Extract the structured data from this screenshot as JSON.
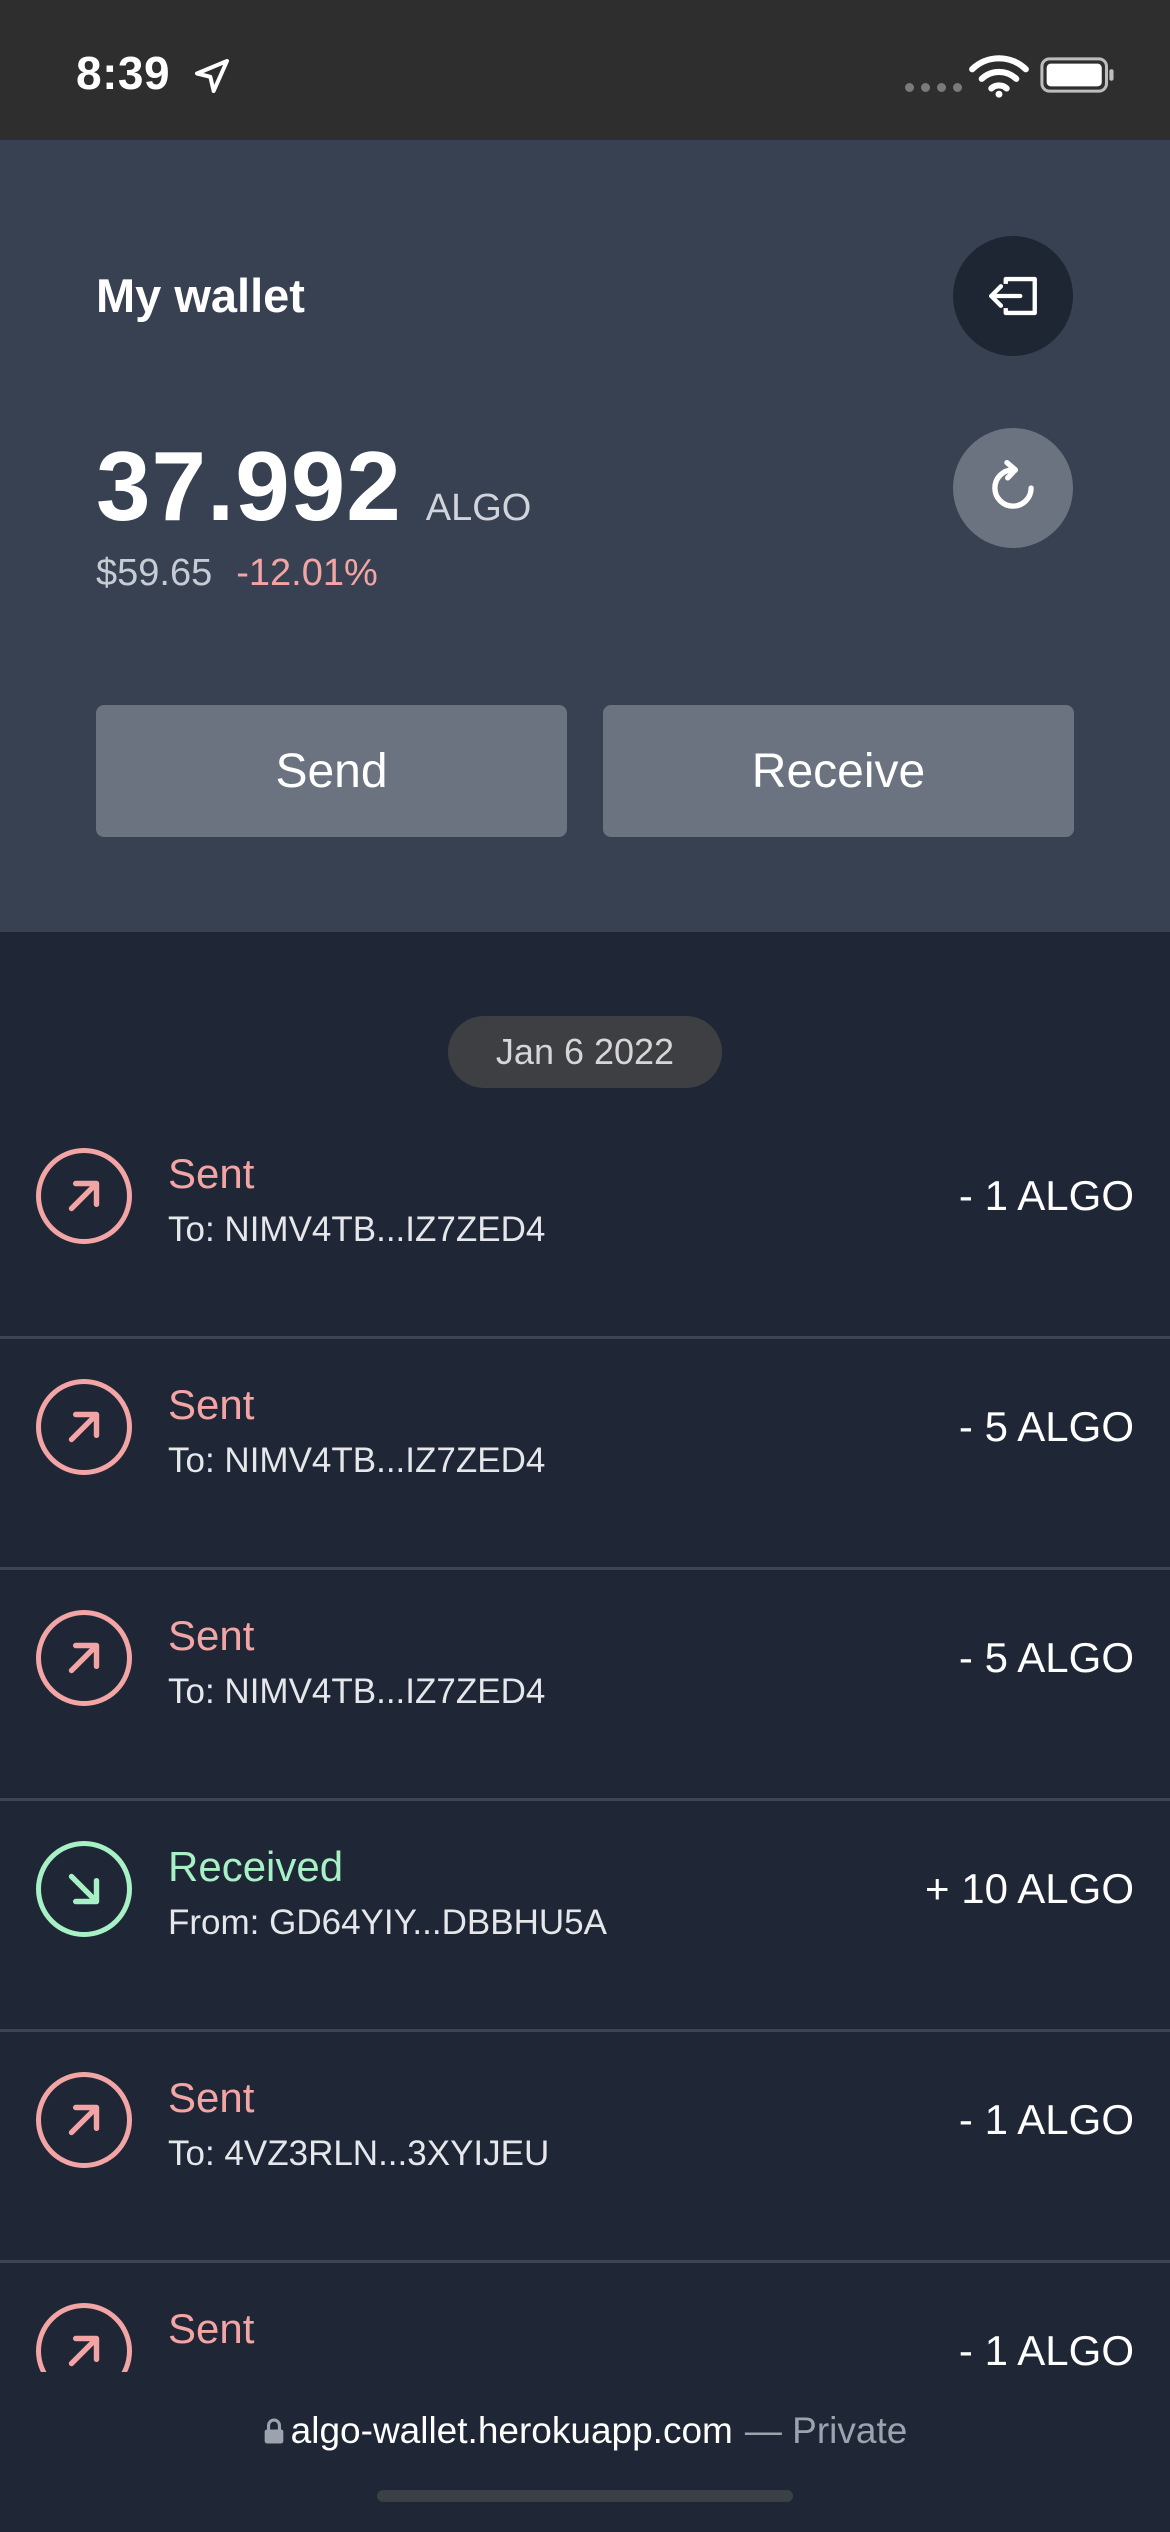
{
  "status_bar": {
    "time": "8:39"
  },
  "wallet": {
    "title": "My wallet",
    "balance": "37.992",
    "unit": "ALGO",
    "fiat_value": "$59.65",
    "change": "-12.01%",
    "send_label": "Send",
    "receive_label": "Receive"
  },
  "transactions": {
    "date": "Jan 6 2022",
    "items": [
      {
        "type": "Sent",
        "party": "To: NIMV4TB...IZ7ZED4",
        "amount": "- 1 ALGO"
      },
      {
        "type": "Sent",
        "party": "To: NIMV4TB...IZ7ZED4",
        "amount": "- 5 ALGO"
      },
      {
        "type": "Sent",
        "party": "To: NIMV4TB...IZ7ZED4",
        "amount": "- 5 ALGO"
      },
      {
        "type": "Received",
        "party": "From: GD64YIY...DBBHU5A",
        "amount": "+ 10 ALGO"
      },
      {
        "type": "Sent",
        "party": "To: 4VZ3RLN...3XYIJEU",
        "amount": "- 1 ALGO"
      },
      {
        "type": "Sent",
        "party": "",
        "amount": "- 1 ALGO"
      }
    ]
  },
  "browser": {
    "host": "algo-wallet.herokuapp.com",
    "private_label": "— Private"
  },
  "icons": {
    "logout": "logout-icon",
    "refresh": "refresh-icon",
    "sent": "arrow-up-right-icon",
    "received": "arrow-down-right-icon"
  },
  "colors": {
    "sent": "#f3a5a5",
    "received": "#a8f0c6",
    "panel": "#374152",
    "background": "#1f2736"
  }
}
